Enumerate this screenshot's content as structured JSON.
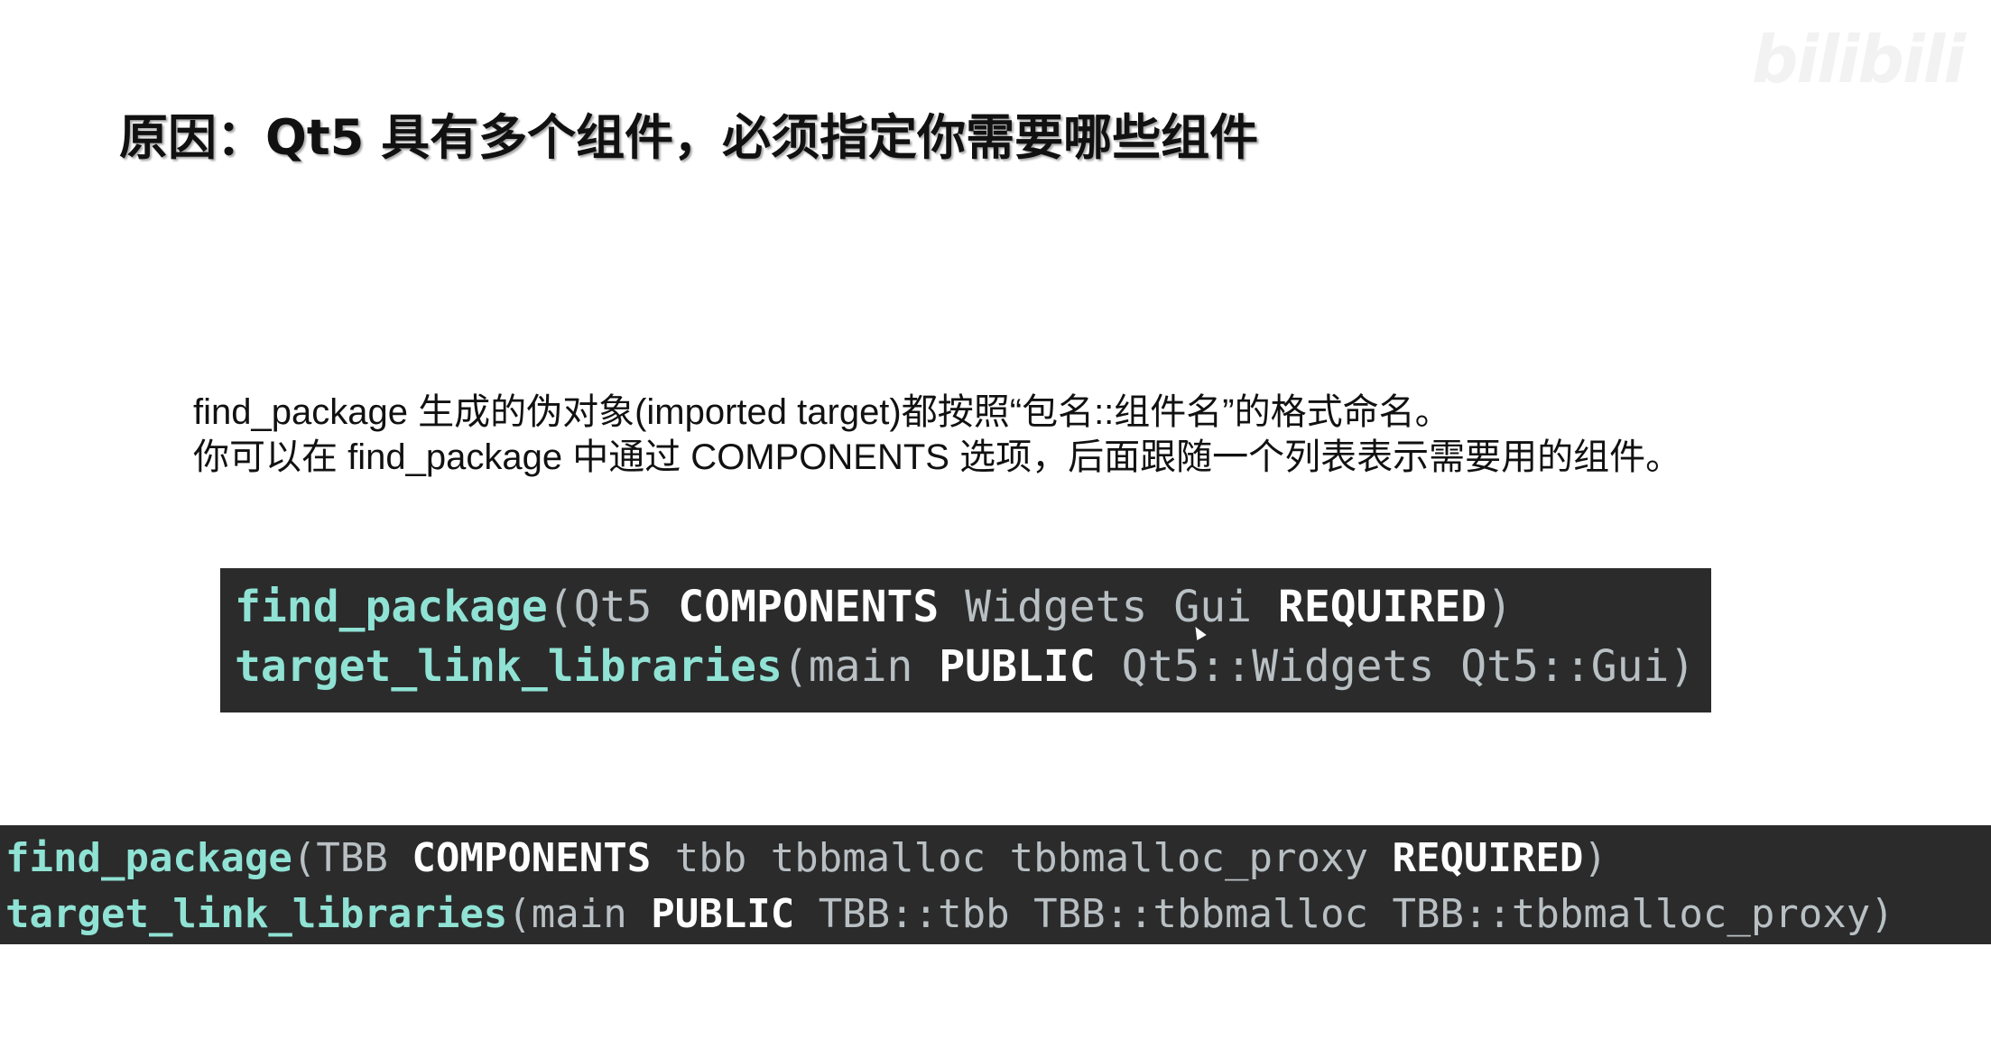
{
  "slide": {
    "title": "原因：Qt5 具有多个组件，必须指定你需要哪些组件",
    "watermark": "bilibili"
  },
  "description": {
    "line1": "find_package 生成的伪对象(imported target)都按照“包名::组件名”的格式命名。",
    "line2": "你可以在 find_package 中通过 COMPONENTS 选项，后面跟随一个列表表示需要用的组件。"
  },
  "code_qt": {
    "line1": {
      "func": "find_package",
      "open": "(",
      "pkg": "Qt5 ",
      "kw_components": "COMPONENTS",
      "comps": " Widgets Gui ",
      "kw_required": "REQUIRED",
      "close": ")"
    },
    "line2": {
      "func": "target_link_libraries",
      "open": "(",
      "target": "main ",
      "kw_public": "PUBLIC",
      "libs": " Qt5::Widgets Qt5::Gui",
      "close": ")"
    }
  },
  "code_tbb": {
    "line1": {
      "func": "find_package",
      "open": "(",
      "pkg": "TBB ",
      "kw_components": "COMPONENTS",
      "comps": " tbb tbbmalloc tbbmalloc_proxy ",
      "kw_required": "REQUIRED",
      "close": ")"
    },
    "line2": {
      "func": "target_link_libraries",
      "open": "(",
      "target": "main ",
      "kw_public": "PUBLIC",
      "libs": " TBB::tbb TBB::tbbmalloc TBB::tbbmalloc_proxy",
      "close": ")"
    }
  },
  "colors": {
    "code_background": "#2b2b2b",
    "function_name": "#8fe2d4",
    "keyword": "#ffffff",
    "argument": "#b9c0c4"
  },
  "icons": {
    "cursor": "mouse-cursor-icon"
  }
}
